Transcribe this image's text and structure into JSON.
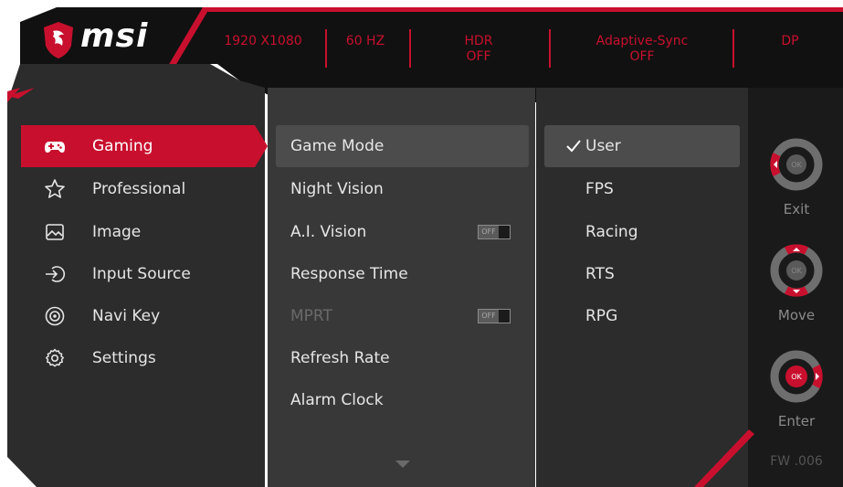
{
  "brand": {
    "name": "msi"
  },
  "status_bar": [
    {
      "line1": "1920 X1080",
      "line2": ""
    },
    {
      "line1": "60 HZ",
      "line2": ""
    },
    {
      "line1": "HDR",
      "line2": "OFF"
    },
    {
      "line1": "Adaptive-Sync",
      "line2": "OFF"
    },
    {
      "line1": "DP",
      "line2": ""
    }
  ],
  "main_menu": [
    {
      "label": "Gaming",
      "icon": "gamepad-icon",
      "selected": true
    },
    {
      "label": "Professional",
      "icon": "star-icon",
      "selected": false
    },
    {
      "label": "Image",
      "icon": "image-icon",
      "selected": false
    },
    {
      "label": "Input Source",
      "icon": "input-source-icon",
      "selected": false
    },
    {
      "label": "Navi Key",
      "icon": "navi-key-icon",
      "selected": false
    },
    {
      "label": "Settings",
      "icon": "gear-icon",
      "selected": false
    }
  ],
  "sub_menu": [
    {
      "label": "Game Mode",
      "selected": true
    },
    {
      "label": "Night Vision"
    },
    {
      "label": "A.I. Vision",
      "toggle": "OFF"
    },
    {
      "label": "Response Time"
    },
    {
      "label": "MPRT",
      "toggle": "OFF",
      "disabled": true
    },
    {
      "label": "Refresh Rate"
    },
    {
      "label": "Alarm Clock"
    }
  ],
  "options": [
    {
      "label": "User",
      "checked": true
    },
    {
      "label": "FPS"
    },
    {
      "label": "Racing"
    },
    {
      "label": "RTS"
    },
    {
      "label": "RPG"
    }
  ],
  "navi": {
    "exit_label": "Exit",
    "move_label": "Move",
    "enter_label": "Enter",
    "ok_text": "OK"
  },
  "firmware": "FW .006",
  "colors": {
    "accent": "#c8102e",
    "panel_bg": "#2c2c2c",
    "column_bg": "#383838",
    "highlight": "#4c4c4c"
  }
}
